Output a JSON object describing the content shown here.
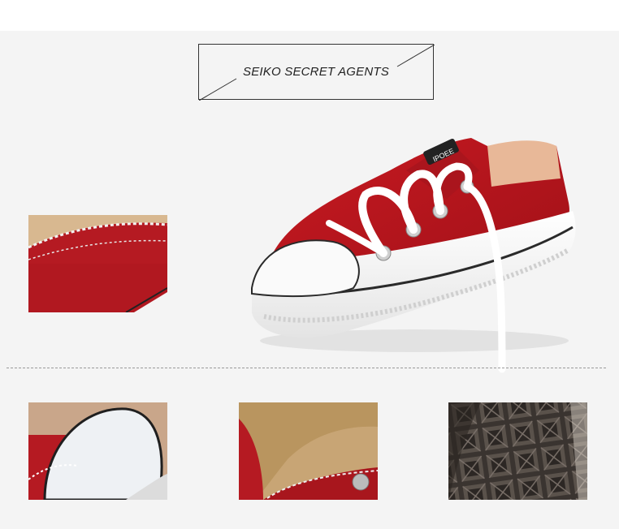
{
  "title": {
    "text": "SEIKO SECRET AGENTS"
  },
  "product": {
    "tongue_label": "IPOEE"
  },
  "colors": {
    "background": "#f4f4f4",
    "canvas_red": "#b3141c",
    "sole_white": "#f7f7f7",
    "divider": "#9a9a9a"
  }
}
